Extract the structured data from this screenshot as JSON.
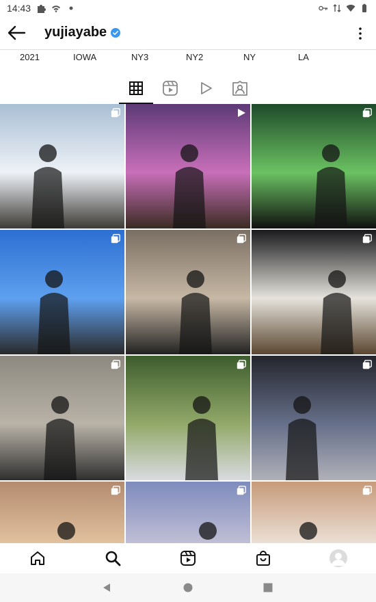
{
  "status_bar": {
    "time": "14:43",
    "left_icons": [
      "puzzle-icon",
      "wifi-call-icon",
      "dot-icon"
    ],
    "right_icons": [
      "key-icon",
      "data-arrows-icon",
      "wifi-icon",
      "battery-icon"
    ]
  },
  "header": {
    "username": "yujiayabe",
    "verified": true,
    "back_icon": "arrow-left-icon",
    "more_icon": "more-vertical-icon"
  },
  "highlights": [
    {
      "label": "2021"
    },
    {
      "label": "IOWA"
    },
    {
      "label": "NY3"
    },
    {
      "label": "NY2"
    },
    {
      "label": "NY"
    },
    {
      "label": "LA"
    }
  ],
  "tabs": [
    {
      "name": "posts-grid",
      "icon": "grid-icon",
      "active": true
    },
    {
      "name": "reels",
      "icon": "reels-icon",
      "active": false
    },
    {
      "name": "videos",
      "icon": "play-icon",
      "active": false
    },
    {
      "name": "tagged",
      "icon": "tagged-person-icon",
      "active": false
    }
  ],
  "grid": {
    "posts": [
      {
        "name": "post-winter-park",
        "badge": "carousel-icon",
        "colors": [
          "#a9bfd4",
          "#eef2f7",
          "#3d3b36"
        ]
      },
      {
        "name": "post-light-show-cathedral",
        "badge": "video-icon",
        "colors": [
          "#5d3a77",
          "#c86fb9",
          "#3a2b22"
        ]
      },
      {
        "name": "post-matrix-premiere",
        "badge": "carousel-icon",
        "colors": [
          "#1f4a2a",
          "#6bc262",
          "#101010"
        ]
      },
      {
        "name": "post-statue-of-liberty",
        "badge": "carousel-icon",
        "colors": [
          "#2c6fd1",
          "#5ea0ef",
          "#2a2a2a"
        ]
      },
      {
        "name": "post-vespa-scooter",
        "badge": "carousel-icon",
        "colors": [
          "#7a6f63",
          "#c7b8a5",
          "#222222"
        ]
      },
      {
        "name": "post-garden-tent",
        "badge": "carousel-icon",
        "colors": [
          "#1a1a1d",
          "#e6e3dc",
          "#5a4630"
        ]
      },
      {
        "name": "post-library-steps",
        "badge": "carousel-icon",
        "colors": [
          "#8d8980",
          "#b9b3a8",
          "#2f2f2f"
        ]
      },
      {
        "name": "post-park-snack",
        "badge": "carousel-icon",
        "colors": [
          "#3d5d2d",
          "#93a96a",
          "#d9dbe0"
        ]
      },
      {
        "name": "post-night-street",
        "badge": "carousel-icon",
        "colors": [
          "#24252d",
          "#66708a",
          "#b0b0b8"
        ]
      },
      {
        "name": "post-sunset-harbor",
        "badge": "carousel-icon",
        "colors": [
          "#b48b6f",
          "#e6c7a3",
          "#3b4652"
        ]
      },
      {
        "name": "post-stadium-dusk",
        "badge": "carousel-icon",
        "colors": [
          "#7e8bbd",
          "#c7c4d8",
          "#6b5040"
        ]
      },
      {
        "name": "post-cafe-portrait",
        "badge": "carousel-icon",
        "colors": [
          "#c79b7a",
          "#efe7de",
          "#2b2b2b"
        ]
      }
    ]
  },
  "bottom_nav": [
    {
      "name": "home",
      "icon": "home-icon"
    },
    {
      "name": "search",
      "icon": "search-icon"
    },
    {
      "name": "reels",
      "icon": "reels-icon"
    },
    {
      "name": "shop",
      "icon": "shopping-bag-icon"
    },
    {
      "name": "profile",
      "icon": "avatar-icon"
    }
  ],
  "system_nav": [
    "back-triangle-icon",
    "home-circle-icon",
    "recents-square-icon"
  ],
  "colors": {
    "text": "#111111",
    "divider": "#e0e0e0",
    "verified": "#3897f0",
    "system_nav_bg": "#f6f6f6"
  }
}
